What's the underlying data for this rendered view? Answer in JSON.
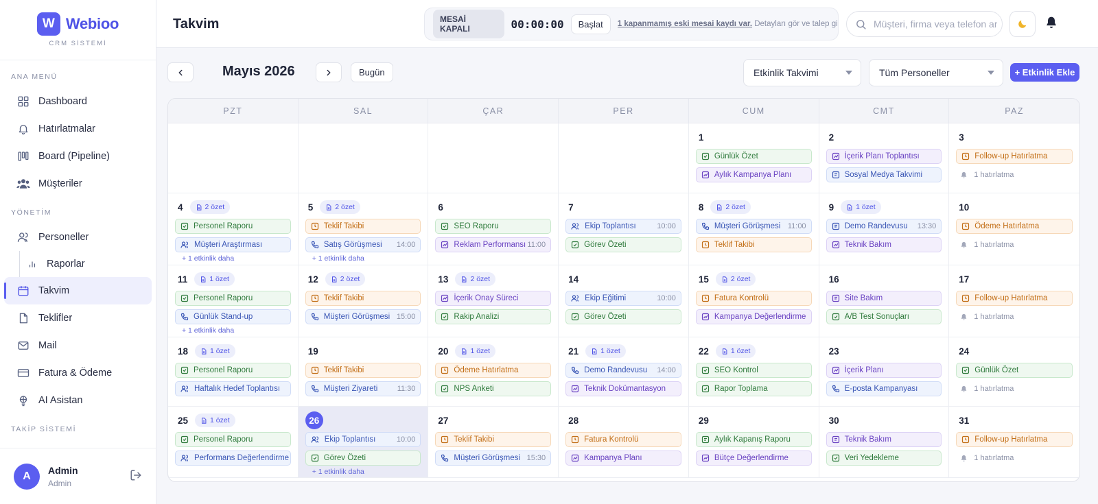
{
  "brand": {
    "logo_letter": "W",
    "name": "Webioo",
    "subtitle": "CRM SİSTEMİ"
  },
  "sidebar": {
    "sections": [
      {
        "label": "ANA MENÜ",
        "items": [
          {
            "label": "Dashboard",
            "icon": "grid-icon"
          },
          {
            "label": "Hatırlatmalar",
            "icon": "bell-icon"
          },
          {
            "label": "Board (Pipeline)",
            "icon": "kanban-icon"
          },
          {
            "label": "Müşteriler",
            "icon": "users-icon"
          }
        ]
      },
      {
        "label": "YÖNETİM",
        "items": [
          {
            "label": "Personeller",
            "icon": "user-group-icon"
          },
          {
            "label": "Raporlar",
            "icon": "bar-chart-icon",
            "sub": true
          },
          {
            "label": "Takvim",
            "icon": "calendar-icon",
            "active": true
          },
          {
            "label": "Teklifler",
            "icon": "document-icon"
          },
          {
            "label": "Mail",
            "icon": "mail-icon"
          },
          {
            "label": "Fatura & Ödeme",
            "icon": "credit-card-icon"
          },
          {
            "label": "AI Asistan",
            "icon": "bulb-icon"
          }
        ]
      },
      {
        "label": "TAKİP SİSTEMİ",
        "items": []
      }
    ],
    "user": {
      "initial": "A",
      "name": "Admin",
      "role": "Admin"
    }
  },
  "header": {
    "title": "Takvim",
    "shift": {
      "status": "MESAİ KAPALI",
      "timer": "00:00:00",
      "start_label": "Başlat",
      "link": "1 kapanmamış eski mesai kaydı var.",
      "note": "Detayları gör ve talep gir."
    },
    "search": {
      "placeholder": "Müşteri, firma veya telefon ara"
    }
  },
  "toolbar": {
    "month": "Mayıs 2026",
    "today_label": "Bugün",
    "calendar_type": "Etkinlik Takvimi",
    "staff_filter": "Tüm Personeller",
    "add_label": "+ Etkinlik Ekle"
  },
  "colors": {
    "accent": "#5b5ef0",
    "green": "#2f7a3c",
    "blue": "#3a56b5",
    "orange": "#c26e16",
    "purple": "#6a43c2"
  },
  "calendar": {
    "weekdays": [
      "PZT",
      "SAL",
      "ÇAR",
      "PER",
      "CUM",
      "CMT",
      "PAZ"
    ],
    "days": [
      {
        "day": "",
        "events": []
      },
      {
        "day": "",
        "events": []
      },
      {
        "day": "",
        "events": []
      },
      {
        "day": "",
        "events": []
      },
      {
        "day": "1",
        "events": [
          {
            "title": "Günlük Özet",
            "color": "green",
            "icon": "check"
          },
          {
            "title": "Aylık Kampanya Planı",
            "color": "purple",
            "icon": "chart"
          }
        ]
      },
      {
        "day": "2",
        "events": [
          {
            "title": "İçerik Planı Toplantısı",
            "color": "purple",
            "icon": "chart"
          },
          {
            "title": "Sosyal Medya Takvimi",
            "color": "blue",
            "icon": "doc"
          }
        ]
      },
      {
        "day": "3",
        "events": [
          {
            "title": "Follow-up Hatırlatma",
            "color": "orange",
            "icon": "clock"
          }
        ],
        "reminder": "1 hatırlatma"
      },
      {
        "day": "4",
        "badge": "2 özet",
        "events": [
          {
            "title": "Personel Raporu",
            "color": "green",
            "icon": "check"
          },
          {
            "title": "Müşteri Araştırması",
            "color": "blue",
            "icon": "users"
          }
        ],
        "more": "+ 1 etkinlik daha"
      },
      {
        "day": "5",
        "badge": "2 özet",
        "events": [
          {
            "title": "Teklif Takibi",
            "color": "orange",
            "icon": "clock"
          },
          {
            "title": "Satış Görüşmesi",
            "color": "blue",
            "icon": "phone",
            "time": "14:00"
          }
        ],
        "more": "+ 1 etkinlik daha"
      },
      {
        "day": "6",
        "events": [
          {
            "title": "SEO Raporu",
            "color": "green",
            "icon": "check"
          },
          {
            "title": "Reklam Performansı",
            "color": "purple",
            "icon": "chart",
            "time": "11:00"
          }
        ]
      },
      {
        "day": "7",
        "events": [
          {
            "title": "Ekip Toplantısı",
            "color": "blue",
            "icon": "users",
            "time": "10:00"
          },
          {
            "title": "Görev Özeti",
            "color": "green",
            "icon": "check"
          }
        ]
      },
      {
        "day": "8",
        "badge": "2 özet",
        "events": [
          {
            "title": "Müşteri Görüşmesi",
            "color": "blue",
            "icon": "phone",
            "time": "11:00"
          },
          {
            "title": "Teklif Takibi",
            "color": "orange",
            "icon": "clock"
          }
        ]
      },
      {
        "day": "9",
        "badge": "1 özet",
        "events": [
          {
            "title": "Demo Randevusu",
            "color": "blue",
            "icon": "doc",
            "time": "13:30"
          },
          {
            "title": "Teknik Bakım",
            "color": "purple",
            "icon": "chart"
          }
        ]
      },
      {
        "day": "10",
        "events": [
          {
            "title": "Ödeme Hatırlatma",
            "color": "orange",
            "icon": "clock"
          }
        ],
        "reminder": "1 hatırlatma"
      },
      {
        "day": "11",
        "badge": "1 özet",
        "events": [
          {
            "title": "Personel Raporu",
            "color": "green",
            "icon": "check"
          },
          {
            "title": "Günlük Stand-up",
            "color": "blue",
            "icon": "phone"
          }
        ],
        "more": "+ 1 etkinlik daha"
      },
      {
        "day": "12",
        "badge": "2 özet",
        "events": [
          {
            "title": "Teklif Takibi",
            "color": "orange",
            "icon": "clock"
          },
          {
            "title": "Müşteri Görüşmesi",
            "color": "blue",
            "icon": "phone",
            "time": "15:00"
          }
        ]
      },
      {
        "day": "13",
        "badge": "2 özet",
        "events": [
          {
            "title": "İçerik Onay Süreci",
            "color": "purple",
            "icon": "chart"
          },
          {
            "title": "Rakip Analizi",
            "color": "green",
            "icon": "check"
          }
        ]
      },
      {
        "day": "14",
        "events": [
          {
            "title": "Ekip Eğitimi",
            "color": "blue",
            "icon": "users",
            "time": "10:00"
          },
          {
            "title": "Görev Özeti",
            "color": "green",
            "icon": "check"
          }
        ]
      },
      {
        "day": "15",
        "badge": "2 özet",
        "events": [
          {
            "title": "Fatura Kontrolü",
            "color": "orange",
            "icon": "clock"
          },
          {
            "title": "Kampanya Değerlendirme",
            "color": "purple",
            "icon": "chart"
          }
        ]
      },
      {
        "day": "16",
        "events": [
          {
            "title": "Site Bakım",
            "color": "purple",
            "icon": "doc"
          },
          {
            "title": "A/B Test Sonuçları",
            "color": "green",
            "icon": "check"
          }
        ]
      },
      {
        "day": "17",
        "events": [
          {
            "title": "Follow-up Hatırlatma",
            "color": "orange",
            "icon": "clock"
          }
        ],
        "reminder": "1 hatırlatma"
      },
      {
        "day": "18",
        "badge": "1 özet",
        "events": [
          {
            "title": "Personel Raporu",
            "color": "green",
            "icon": "check"
          },
          {
            "title": "Haftalık Hedef Toplantısı",
            "color": "blue",
            "icon": "users"
          }
        ]
      },
      {
        "day": "19",
        "events": [
          {
            "title": "Teklif Takibi",
            "color": "orange",
            "icon": "clock"
          },
          {
            "title": "Müşteri Ziyareti",
            "color": "blue",
            "icon": "phone",
            "time": "11:30"
          }
        ]
      },
      {
        "day": "20",
        "badge": "1 özet",
        "events": [
          {
            "title": "Ödeme Hatırlatma",
            "color": "orange",
            "icon": "clock"
          },
          {
            "title": "NPS Anketi",
            "color": "green",
            "icon": "check"
          }
        ]
      },
      {
        "day": "21",
        "badge": "1 özet",
        "events": [
          {
            "title": "Demo Randevusu",
            "color": "blue",
            "icon": "phone",
            "time": "14:00"
          },
          {
            "title": "Teknik Dokümantasyon",
            "color": "purple",
            "icon": "chart"
          }
        ]
      },
      {
        "day": "22",
        "badge": "1 özet",
        "events": [
          {
            "title": "SEO Kontrol",
            "color": "green",
            "icon": "check"
          },
          {
            "title": "Rapor Toplama",
            "color": "green",
            "icon": "check"
          }
        ]
      },
      {
        "day": "23",
        "events": [
          {
            "title": "İçerik Planı",
            "color": "purple",
            "icon": "chart"
          },
          {
            "title": "E-posta Kampanyası",
            "color": "blue",
            "icon": "phone"
          }
        ]
      },
      {
        "day": "24",
        "events": [
          {
            "title": "Günlük Özet",
            "color": "green",
            "icon": "check"
          }
        ],
        "reminder": "1 hatırlatma"
      },
      {
        "day": "25",
        "badge": "1 özet",
        "events": [
          {
            "title": "Personel Raporu",
            "color": "green",
            "icon": "check"
          },
          {
            "title": "Performans Değerlendirme",
            "color": "blue",
            "icon": "users"
          }
        ]
      },
      {
        "day": "26",
        "today": true,
        "events": [
          {
            "title": "Ekip Toplantısı",
            "color": "blue",
            "icon": "users",
            "time": "10:00"
          },
          {
            "title": "Görev Özeti",
            "color": "green",
            "icon": "check"
          }
        ],
        "more": "+ 1 etkinlik daha"
      },
      {
        "day": "27",
        "events": [
          {
            "title": "Teklif Takibi",
            "color": "orange",
            "icon": "clock"
          },
          {
            "title": "Müşteri Görüşmesi",
            "color": "blue",
            "icon": "phone",
            "time": "15:30"
          }
        ]
      },
      {
        "day": "28",
        "events": [
          {
            "title": "Fatura Kontrolü",
            "color": "orange",
            "icon": "clock"
          },
          {
            "title": "Kampanya Planı",
            "color": "purple",
            "icon": "chart"
          }
        ]
      },
      {
        "day": "29",
        "events": [
          {
            "title": "Aylık Kapanış Raporu",
            "color": "green",
            "icon": "doc"
          },
          {
            "title": "Bütçe Değerlendirme",
            "color": "purple",
            "icon": "chart"
          }
        ]
      },
      {
        "day": "30",
        "events": [
          {
            "title": "Teknik Bakım",
            "color": "purple",
            "icon": "doc"
          },
          {
            "title": "Veri Yedekleme",
            "color": "green",
            "icon": "check"
          }
        ]
      },
      {
        "day": "31",
        "events": [
          {
            "title": "Follow-up Hatırlatma",
            "color": "orange",
            "icon": "clock"
          }
        ],
        "reminder": "1 hatırlatma"
      }
    ]
  }
}
